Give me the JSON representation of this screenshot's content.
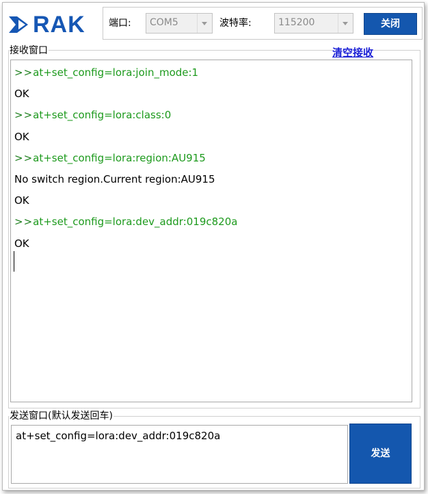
{
  "app": {
    "logo_text": "RAK",
    "brand_color": "#1657b4"
  },
  "settings": {
    "port_label": "端口:",
    "port_value": "COM5",
    "baud_label": "波特率:",
    "baud_value": "115200",
    "close_button": "关闭"
  },
  "receive": {
    "group_label": "接收窗口",
    "clear_link": "清空接收",
    "lines": [
      {
        "prompt": ">>",
        "text": "at+set_config=lora:join_mode:1"
      },
      {
        "prompt": "",
        "text": "OK"
      },
      {
        "prompt": ">>",
        "text": "at+set_config=lora:class:0"
      },
      {
        "prompt": "",
        "text": "OK"
      },
      {
        "prompt": ">>",
        "text": "at+set_config=lora:region:AU915"
      },
      {
        "prompt": "",
        "text": "No switch region.Current region:AU915"
      },
      {
        "prompt": "",
        "text": "OK"
      },
      {
        "prompt": ">>",
        "text": "at+set_config=lora:dev_addr:019c820a"
      },
      {
        "prompt": "",
        "text": "OK"
      }
    ],
    "command_color": "#1d9a1d"
  },
  "send": {
    "group_label": "发送窗口(默认发送回车)",
    "input_value": "at+set_config=lora:dev_addr:019c820a",
    "send_button": "发送"
  }
}
